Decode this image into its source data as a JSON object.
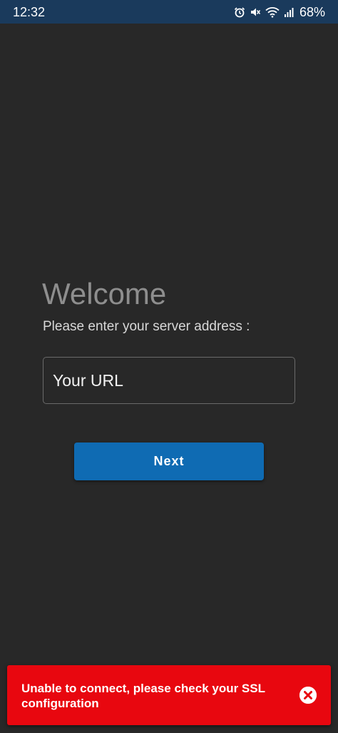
{
  "status_bar": {
    "time": "12:32",
    "battery": "68%",
    "icons": [
      "alarm-icon",
      "mute-icon",
      "wifi-icon",
      "signal-icon"
    ]
  },
  "main": {
    "title": "Welcome",
    "subtitle": "Please enter your server address :",
    "url_placeholder": "Your URL",
    "next_label": "Next"
  },
  "toast": {
    "message": "Unable to connect, please check your SSL configuration",
    "close_icon": "close-icon"
  },
  "colors": {
    "background": "#282828",
    "status_bar": "#1a3a5c",
    "primary_button": "#0f6bb3",
    "error": "#e8070f"
  }
}
